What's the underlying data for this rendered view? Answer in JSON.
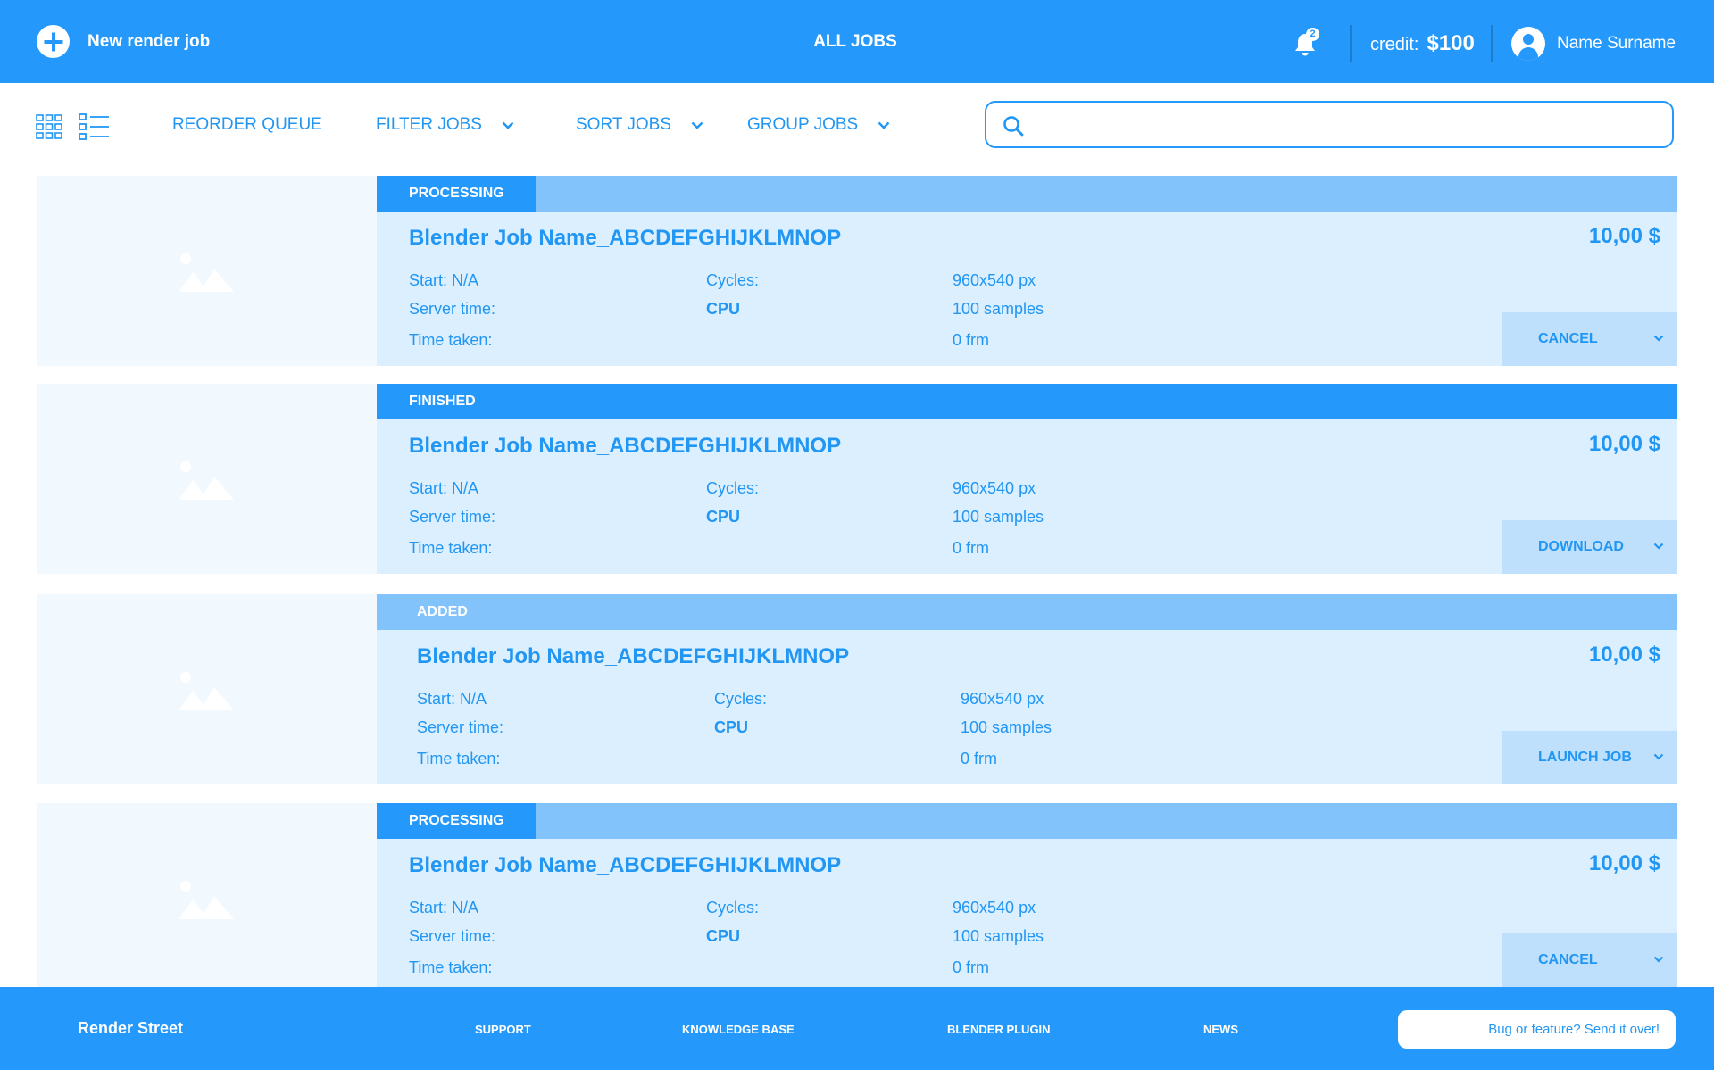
{
  "header": {
    "new_job_label": "New render job",
    "title": "ALL JOBS",
    "notification_count": "2",
    "credit_label": "credit:",
    "credit_amount": "$100",
    "user_name": "Name Surname"
  },
  "toolbar": {
    "reorder_label": "REORDER QUEUE",
    "filter_label": "FILTER JOBS",
    "sort_label": "SORT JOBS",
    "group_label": "GROUP JOBS",
    "search_value": ""
  },
  "labels": {
    "start": "Start: N/A",
    "server_time": "Server time:",
    "time_taken": "Time taken:",
    "cycles": "Cycles:",
    "cpu": "CPU",
    "resolution": "960x540 px",
    "samples": "100 samples",
    "frames": "0 frm"
  },
  "jobs": [
    {
      "status": "PROCESSING",
      "name": "Blender Job Name_ABCDEFGHIJKLMNOP",
      "price": "10,00 $",
      "action": "CANCEL"
    },
    {
      "status": "FINISHED",
      "name": "Blender Job Name_ABCDEFGHIJKLMNOP",
      "price": "10,00 $",
      "action": "DOWNLOAD"
    },
    {
      "status": "ADDED",
      "name": "Blender Job Name_ABCDEFGHIJKLMNOP",
      "price": "10,00 $",
      "action": "LAUNCH JOB"
    },
    {
      "status": "PROCESSING",
      "name": "Blender Job Name_ABCDEFGHIJKLMNOP",
      "price": "10,00 $",
      "action": "CANCEL"
    }
  ],
  "footer": {
    "brand": "Render Street",
    "links": [
      "SUPPORT",
      "KNOWLEDGE BASE",
      "BLENDER PLUGIN",
      "NEWS"
    ],
    "feedback_label": "Bug or feature? Send it over!"
  },
  "colors": {
    "primary": "#2499fb",
    "processing_track": "#82c3fc",
    "card_bg": "#dcefff",
    "thumb_bg": "#f1f8fe",
    "action_bg": "#bfe0fd"
  }
}
